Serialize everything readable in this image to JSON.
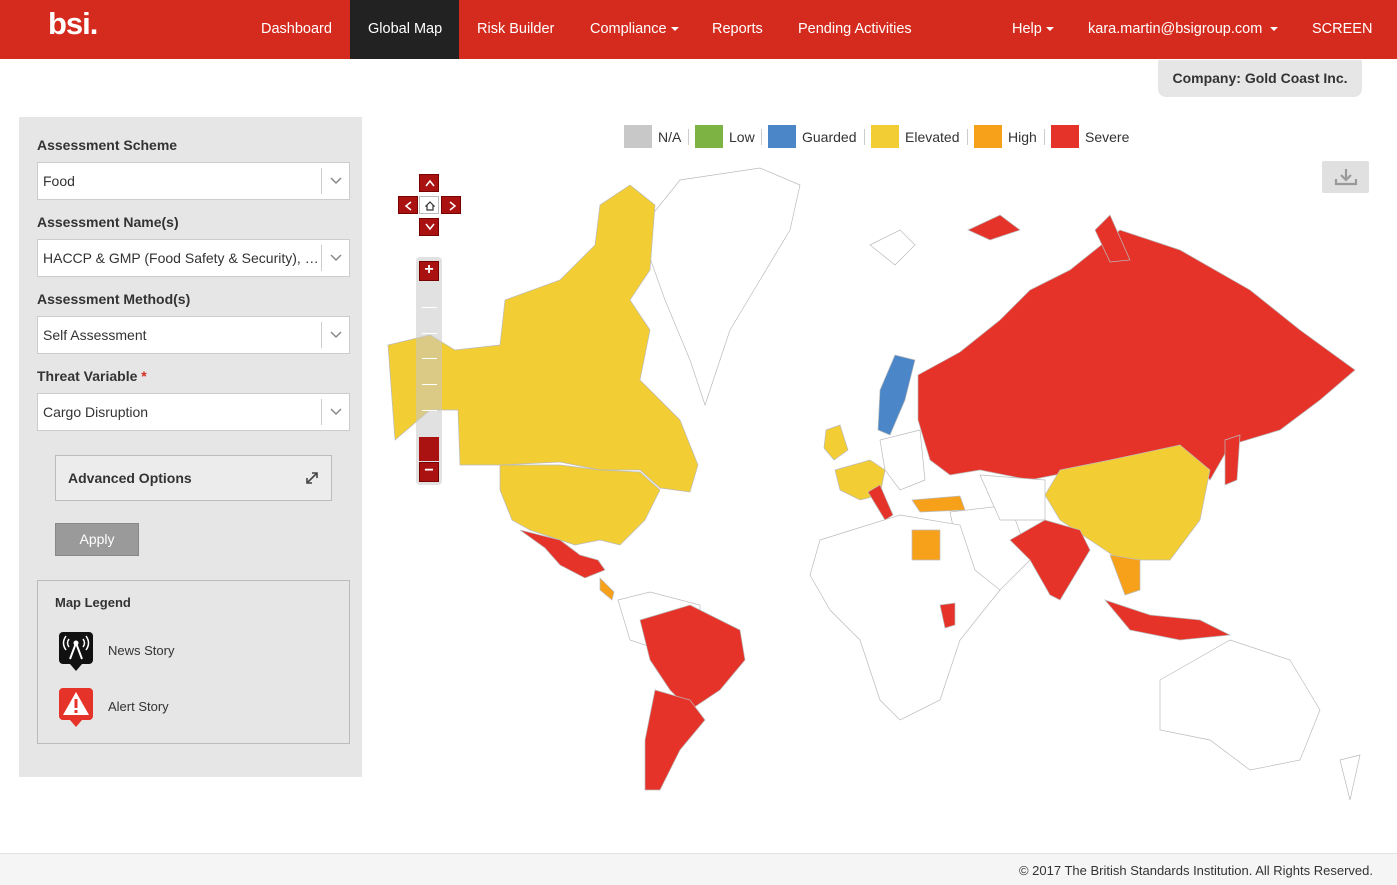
{
  "brand": {
    "logo_text": "bsi."
  },
  "nav": {
    "dashboard": "Dashboard",
    "global_map": "Global Map",
    "risk_builder": "Risk Builder",
    "compliance": "Compliance",
    "reports": "Reports",
    "pending": "Pending Activities",
    "help": "Help",
    "user": "kara.martin@bsigroup.com",
    "screen": "SCREEN"
  },
  "company": "Company: Gold Coast Inc.",
  "filters": {
    "scheme_label": "Assessment Scheme",
    "scheme_value": "Food",
    "name_label": "Assessment Name(s)",
    "name_value": "HACCP & GMP (Food Safety & Security), Food Defense",
    "method_label": "Assessment Method(s)",
    "method_value": "Self Assessment",
    "threat_label": "Threat Variable",
    "threat_required": "*",
    "threat_value": "Cargo Disruption",
    "advanced": "Advanced Options",
    "apply": "Apply"
  },
  "map_legend": {
    "title": "Map Legend",
    "news": "News Story",
    "alert": "Alert Story"
  },
  "risk_levels": [
    {
      "label": "N/A",
      "color": "#c8c8c8"
    },
    {
      "label": "Low",
      "color": "#7db343"
    },
    {
      "label": "Guarded",
      "color": "#4a86c8"
    },
    {
      "label": "Elevated",
      "color": "#f2cd33"
    },
    {
      "label": "High",
      "color": "#f7a11a"
    },
    {
      "label": "Severe",
      "color": "#e5332a"
    }
  ],
  "footer": "© 2017 The British Standards Institution. All Rights Reserved."
}
